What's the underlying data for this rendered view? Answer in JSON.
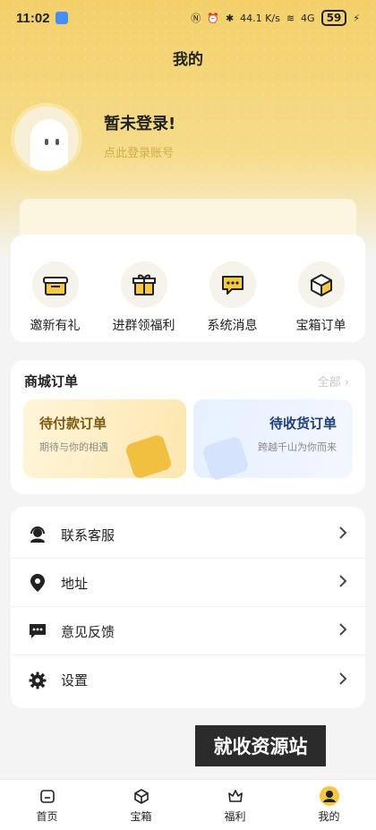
{
  "status_bar": {
    "time": "11:02",
    "network_speed": "44.1 K/s",
    "signal": "4G",
    "battery": "59"
  },
  "header": {
    "title": "我的"
  },
  "user": {
    "name": "暂未登录!",
    "subtitle": "点此登录账号"
  },
  "quick_actions": [
    {
      "label": "邀新有礼",
      "icon": "gift-box-icon"
    },
    {
      "label": "进群领福利",
      "icon": "present-icon"
    },
    {
      "label": "系统消息",
      "icon": "message-icon"
    },
    {
      "label": "宝箱订单",
      "icon": "cube-icon"
    }
  ],
  "orders": {
    "title": "商城订单",
    "all_label": "全部",
    "pending_pay": {
      "title": "待付款订单",
      "desc": "期待与你的相遇"
    },
    "pending_receive": {
      "title": "待收货订单",
      "desc": "跨越千山为你而来"
    }
  },
  "menu": [
    {
      "label": "联系客服",
      "icon": "customer-service-icon"
    },
    {
      "label": "地址",
      "icon": "location-pin-icon"
    },
    {
      "label": "意见反馈",
      "icon": "feedback-icon"
    },
    {
      "label": "设置",
      "icon": "gear-icon"
    }
  ],
  "watermark": "就收资源站",
  "tabs": [
    {
      "label": "首页",
      "icon": "home-icon"
    },
    {
      "label": "宝箱",
      "icon": "box-icon"
    },
    {
      "label": "福利",
      "icon": "welfare-icon"
    },
    {
      "label": "我的",
      "icon": "profile-icon",
      "active": true
    }
  ],
  "colors": {
    "accent": "#f3d06a",
    "brand_text": "#d0ac4b",
    "primary_text": "#222222"
  }
}
